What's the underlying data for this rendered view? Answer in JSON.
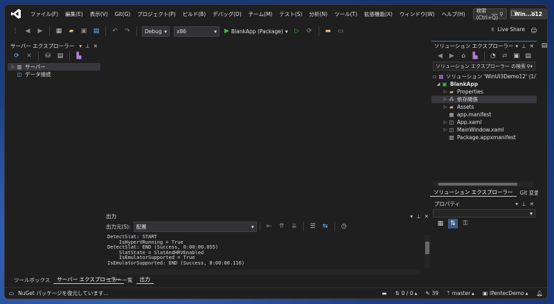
{
  "menu": {
    "items": [
      "ファイル(F)",
      "編集(E)",
      "表示(V)",
      "Git(G)",
      "プロジェクト(P)",
      "ビルド(B)",
      "デバッグ(D)",
      "チーム(M)",
      "テスト(S)",
      "分析(N)",
      "ツール(T)",
      "拡張機能(X)",
      "ウィンドウ(W)",
      "ヘルプ(H)"
    ],
    "search_label": "検索 (Ctrl+Q)",
    "solution_badge": "Win...o12"
  },
  "toolbar": {
    "config": "Debug",
    "platform": "x86",
    "run_label": "BlankApp (Package)",
    "live_share": "Live Share"
  },
  "server_explorer": {
    "title": "サーバー エクスプローラー",
    "items": [
      {
        "label": "サーバー",
        "selected": true
      },
      {
        "label": "データ接続",
        "selected": false
      }
    ]
  },
  "left_tabs": [
    "ツールボックス",
    "サーバー エクスプローラー"
  ],
  "solution_explorer": {
    "title": "ソリューション エクスプローラー",
    "search_placeholder": "ソリューション エクスプローラー の検索 (Ctrl+;)",
    "solution_label": "ソリューション 'WinUI3Demo12' (1/1 のプロジ",
    "project": "BlankApp",
    "items": [
      {
        "label": "Properties",
        "expandable": true,
        "icon": "wrench-folder-icon",
        "selected": false
      },
      {
        "label": "依存関係",
        "expandable": true,
        "icon": "dependencies-icon",
        "selected": true
      },
      {
        "label": "Assets",
        "expandable": true,
        "icon": "folder-icon",
        "selected": false
      },
      {
        "label": "app.manifest",
        "expandable": false,
        "icon": "manifest-icon",
        "selected": false
      },
      {
        "label": "App.xaml",
        "expandable": true,
        "icon": "xaml-icon",
        "selected": false
      },
      {
        "label": "MainWindow.xaml",
        "expandable": true,
        "icon": "xaml-icon",
        "selected": false
      },
      {
        "label": "Package.appxmanifest",
        "expandable": false,
        "icon": "package-icon",
        "selected": false
      }
    ]
  },
  "right_tabs": [
    "ソリューション エクスプローラー",
    "Git 変更"
  ],
  "properties": {
    "title": "プロパティ"
  },
  "output": {
    "title": "出力",
    "source_label": "出力元(S):",
    "source_value": "配置",
    "lines": [
      "DetectSlat: START",
      "    IsHyperVRunning = True",
      "DetectSlat: END (Success, 0:00:00.055)",
      "    SlatState = SlatAndHRVEnabled",
      "    IsEmulatorSupported = True",
      "IsEmulatorSupported: END (Success, 0:00:00.116)"
    ]
  },
  "bottom_tabs": [
    "エラー一覧",
    "出力"
  ],
  "statusbar": {
    "message": "NuGet パッケージを復元しています...",
    "changes": "0 / 0",
    "edits": "39",
    "branch": "master",
    "repo": "iPentecDemo"
  },
  "colors": {
    "accent": "#3fb950",
    "vs_purple": "#8a63d2",
    "folder": "#dcb67a"
  }
}
